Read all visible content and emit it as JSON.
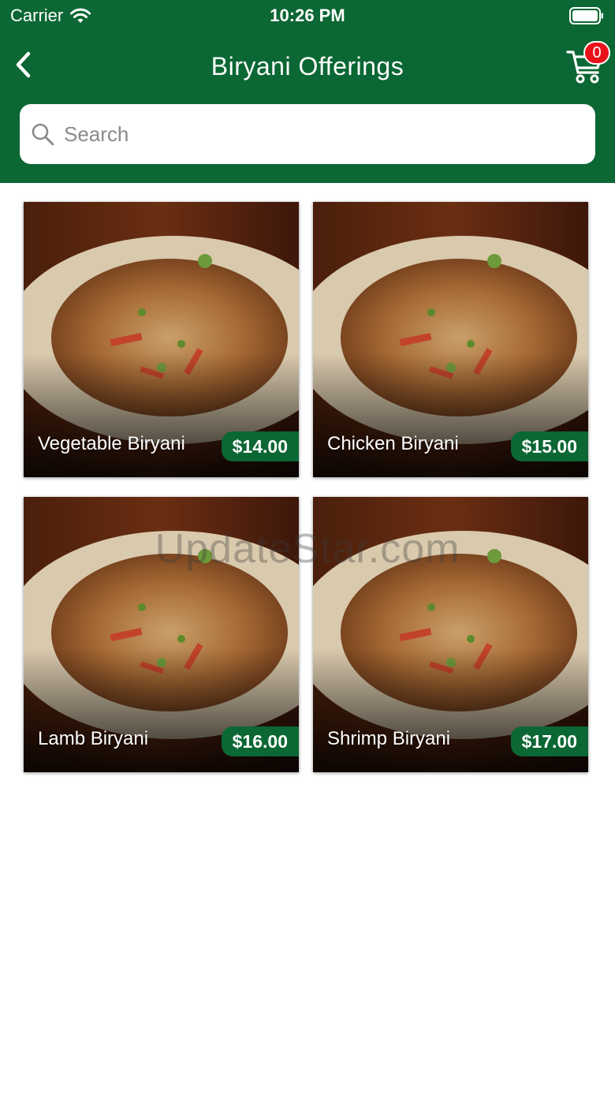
{
  "status_bar": {
    "carrier": "Carrier",
    "time": "10:26 PM"
  },
  "nav": {
    "title": "Biryani Offerings",
    "cart_count": "0"
  },
  "search": {
    "placeholder": "Search",
    "value": ""
  },
  "items": [
    {
      "name": "Vegetable Biryani",
      "price": "$14.00"
    },
    {
      "name": "Chicken Biryani",
      "price": "$15.00"
    },
    {
      "name": "Lamb Biryani",
      "price": "$16.00"
    },
    {
      "name": "Shrimp Biryani",
      "price": "$17.00"
    }
  ],
  "watermark": "UpdateStar.com",
  "colors": {
    "brand_green": "#0b6733",
    "badge_red": "#e8121b"
  },
  "icons": [
    "wifi-icon",
    "battery-icon",
    "back-chevron-icon",
    "cart-icon",
    "search-icon"
  ]
}
